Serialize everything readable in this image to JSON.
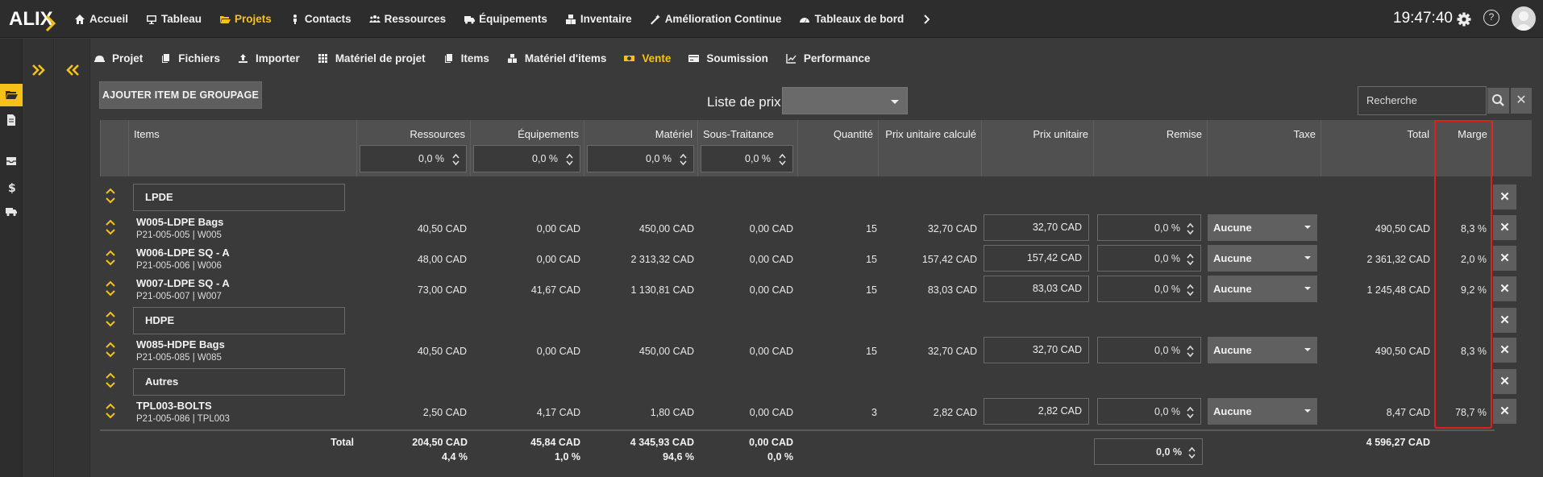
{
  "app": {
    "logo_text": "ALIX",
    "clock": "19:47:40",
    "help_label": "?"
  },
  "nav": [
    {
      "label": "Accueil",
      "icon": "home-icon"
    },
    {
      "label": "Tableau",
      "icon": "monitor-icon"
    },
    {
      "label": "Projets",
      "icon": "folder-open-icon",
      "active": true
    },
    {
      "label": "Contacts",
      "icon": "person-icon"
    },
    {
      "label": "Ressources",
      "icon": "group-icon"
    },
    {
      "label": "Équipements",
      "icon": "truck-icon"
    },
    {
      "label": "Inventaire",
      "icon": "boxes-icon"
    },
    {
      "label": "Amélioration Continue",
      "icon": "wand-icon"
    },
    {
      "label": "Tableaux de bord",
      "icon": "gauge-icon"
    }
  ],
  "subnav": [
    {
      "label": "Projet",
      "icon": "helmet-icon"
    },
    {
      "label": "Fichiers",
      "icon": "copy-icon"
    },
    {
      "label": "Importer",
      "icon": "upload-icon"
    },
    {
      "label": "Matériel de projet",
      "icon": "grid-icon"
    },
    {
      "label": "Items",
      "icon": "copy-icon"
    },
    {
      "label": "Matériel d'items",
      "icon": "boxes-icon"
    },
    {
      "label": "Vente",
      "icon": "money-icon",
      "active": true
    },
    {
      "label": "Soumission",
      "icon": "card-icon"
    },
    {
      "label": "Performance",
      "icon": "chart-line-icon"
    }
  ],
  "toolbar": {
    "add_group_label": "AJOUTER ITEM DE GROUPAGE",
    "price_list_label": "Liste de prix:",
    "price_list_value": "",
    "search_placeholder": "Recherche",
    "clear_label": "✕"
  },
  "columns": {
    "items": "Items",
    "ressources": "Ressources",
    "equipements": "Équipements",
    "materiel": "Matériel",
    "sous_traitance": "Sous-Traitance",
    "quantite": "Quantité",
    "prix_calc": "Prix unitaire calculé",
    "prix_unitaire": "Prix unitaire",
    "remise": "Remise",
    "taxe": "Taxe",
    "total": "Total",
    "marge": "Marge"
  },
  "header_pct": {
    "ressources": "0,0 %",
    "equipements": "0,0 %",
    "materiel": "0,0 %",
    "sous_traitance": "0,0 %"
  },
  "groups": {
    "g1": "LPDE",
    "g2": "HDPE",
    "g3": "Autres"
  },
  "rows": [
    {
      "name": "W005-LDPE Bags",
      "code": "P21-005-005 | W005",
      "ressources": "40,50 CAD",
      "equipements": "0,00 CAD",
      "materiel": "450,00 CAD",
      "sous_traitance": "0,00 CAD",
      "quantite": "15",
      "prix_calc": "32,70 CAD",
      "prix_unitaire": "32,70 CAD",
      "remise": "0,0 %",
      "taxe": "Aucune",
      "total": "490,50 CAD",
      "marge": "8,3  %"
    },
    {
      "name": "W006-LDPE SQ - A",
      "code": "P21-005-006 | W006",
      "ressources": "48,00 CAD",
      "equipements": "0,00 CAD",
      "materiel": "2 313,32 CAD",
      "sous_traitance": "0,00 CAD",
      "quantite": "15",
      "prix_calc": "157,42 CAD",
      "prix_unitaire": "157,42 CAD",
      "remise": "0,0 %",
      "taxe": "Aucune",
      "total": "2 361,32 CAD",
      "marge": "2,0  %"
    },
    {
      "name": "W007-LDPE SQ - A",
      "code": "P21-005-007 | W007",
      "ressources": "73,00 CAD",
      "equipements": "41,67 CAD",
      "materiel": "1 130,81 CAD",
      "sous_traitance": "0,00 CAD",
      "quantite": "15",
      "prix_calc": "83,03 CAD",
      "prix_unitaire": "83,03 CAD",
      "remise": "0,0 %",
      "taxe": "Aucune",
      "total": "1 245,48 CAD",
      "marge": "9,2  %"
    },
    {
      "name": "W085-HDPE Bags",
      "code": "P21-005-085 | W085",
      "ressources": "40,50 CAD",
      "equipements": "0,00 CAD",
      "materiel": "450,00 CAD",
      "sous_traitance": "0,00 CAD",
      "quantite": "15",
      "prix_calc": "32,70 CAD",
      "prix_unitaire": "32,70 CAD",
      "remise": "0,0 %",
      "taxe": "Aucune",
      "total": "490,50 CAD",
      "marge": "8,3  %"
    },
    {
      "name": "TPL003-BOLTS",
      "code": "P21-005-086 | TPL003",
      "ressources": "2,50 CAD",
      "equipements": "4,17 CAD",
      "materiel": "1,80 CAD",
      "sous_traitance": "0,00 CAD",
      "quantite": "3",
      "prix_calc": "2,82 CAD",
      "prix_unitaire": "2,82 CAD",
      "remise": "0,0 %",
      "taxe": "Aucune",
      "total": "8,47 CAD",
      "marge": "78,7  %"
    }
  ],
  "totals": {
    "label": "Total",
    "ressources": "204,50 CAD",
    "ressources_pct": "4,4  %",
    "equipements": "45,84 CAD",
    "equipements_pct": "1,0  %",
    "materiel": "4 345,93 CAD",
    "materiel_pct": "94,6  %",
    "sous_traitance": "0,00 CAD",
    "sous_traitance_pct": "0,0  %",
    "remise": "0,0 %",
    "total": "4 596,27 CAD"
  },
  "colors": {
    "accent": "#f6c21a",
    "highlight": "#e0201f"
  }
}
